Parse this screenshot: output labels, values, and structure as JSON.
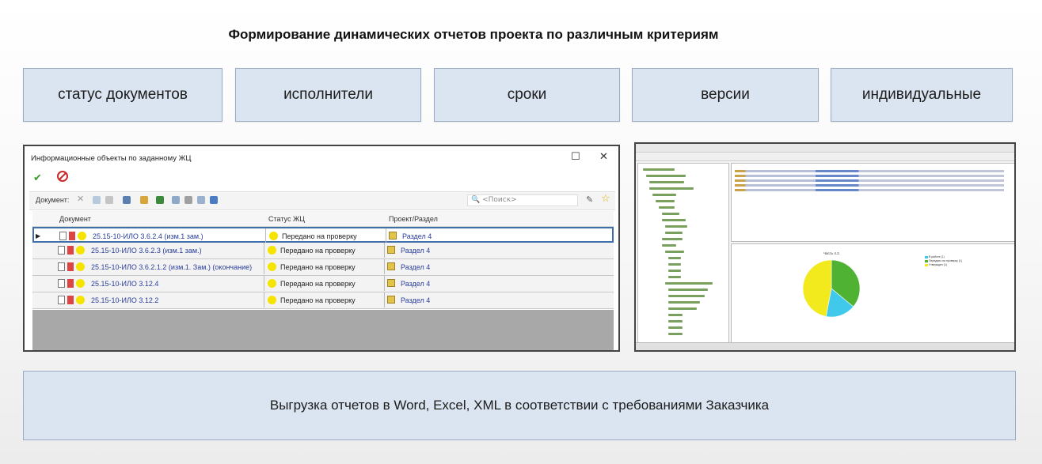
{
  "slide": {
    "title": "Формирование динамических отчетов проекта по различным критериям",
    "criteria": [
      "статус документов",
      "исполнители",
      "сроки",
      "версии",
      "индивидуальные"
    ],
    "export_text": "Выгрузка отчетов в Word, Excel, XML в соответствии с требованиями Заказчика"
  },
  "dialog": {
    "title": "Информационные объекты по заданному ЖЦ",
    "toolbar_label": "Документ:",
    "search_placeholder": "<Поиск>",
    "columns": [
      "Документ",
      "Статус ЖЦ",
      "Проект/Раздел"
    ],
    "rows": [
      {
        "doc": "25.15-10-ИЛО 3.6.2.4 (изм.1 зам.)",
        "status": "Передано на проверку",
        "project": "Раздел 4"
      },
      {
        "doc": "25.15-10-ИЛО 3.6.2.3 (изм.1 зам.)",
        "status": "Передано на проверку",
        "project": "Раздел 4"
      },
      {
        "doc": "25.15-10-ИЛО 3.6.2.1.2 (изм.1. Зам.) (окончание)",
        "status": "Передано на проверку",
        "project": "Раздел 4"
      },
      {
        "doc": "25.15-10-ИЛО 3.12.4",
        "status": "Передано на проверку",
        "project": "Раздел 4"
      },
      {
        "doc": "25.15-10-ИЛО 3.12.2",
        "status": "Передано на проверку",
        "project": "Раздел 4"
      }
    ]
  },
  "screenshot_chart": {
    "title": "Часть 4.2.",
    "colors": {
      "green": "#4fb233",
      "yellow": "#f2ea1c",
      "cyan": "#41c9ec"
    },
    "slices": [
      {
        "color": "green",
        "fraction": 0.36
      },
      {
        "color": "cyan",
        "fraction": 0.17
      },
      {
        "color": "yellow",
        "fraction": 0.47
      }
    ],
    "legend": [
      "В работе (1)",
      "Передано на проверку (1)",
      "Утвержден (1)"
    ]
  },
  "colors": {
    "panel_fill": "#dbe5f1",
    "panel_border": "#9aabc2",
    "link_blue": "#2a3d9a",
    "status_yellow": "#f5e400"
  },
  "icons": [
    "check-icon",
    "cancel-icon",
    "delete-icon",
    "copy-icon",
    "search-icon",
    "star-icon",
    "document-icon",
    "status-dot-icon",
    "folder-icon",
    "row-selector-icon",
    "maximize-icon",
    "close-icon"
  ]
}
